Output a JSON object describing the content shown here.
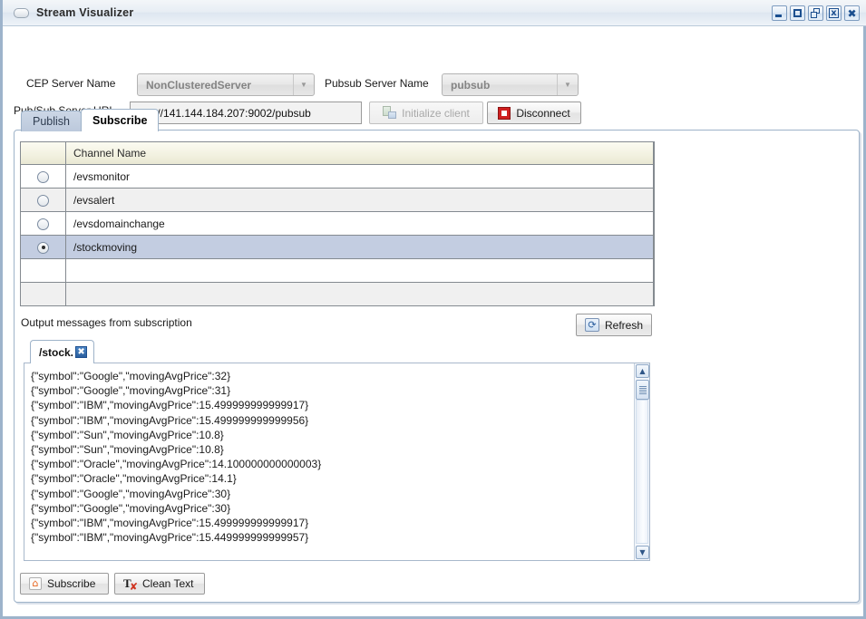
{
  "window": {
    "title": "Stream Visualizer",
    "icon": "pill-icon",
    "buttons": [
      {
        "name": "minimize",
        "label": "_"
      },
      {
        "name": "maximize",
        "label": "□"
      },
      {
        "name": "restore",
        "label": "❐"
      },
      {
        "name": "close-box",
        "label": "x"
      },
      {
        "name": "close",
        "label": "✖"
      }
    ]
  },
  "form": {
    "cep_server_label": "CEP Server Name",
    "cep_server_value": "NonClusteredServer",
    "pubsub_server_label": "Pubsub Server Name",
    "pubsub_server_value": "pubsub",
    "url_label": "Pub/Sub Server URL",
    "url_value": "http://141.144.184.207:9002/pubsub",
    "initialize_label": "Initialize client",
    "initialize_enabled": false,
    "disconnect_label": "Disconnect"
  },
  "tabs": [
    {
      "label": "Publish",
      "active": false
    },
    {
      "label": "Subscribe",
      "active": true
    }
  ],
  "channel_table": {
    "header": "Channel Name",
    "rows": [
      {
        "name": "/evsmonitor",
        "selected": false
      },
      {
        "name": "/evsalert",
        "selected": false
      },
      {
        "name": "/evsdomainchange",
        "selected": false
      },
      {
        "name": "/stockmoving",
        "selected": true
      },
      {
        "name": "",
        "selected": false
      },
      {
        "name": "",
        "selected": false
      }
    ]
  },
  "output": {
    "label": "Output messages from subscription",
    "refresh_label": "Refresh",
    "subtab_label": "/stock.",
    "subtab_close": "✖",
    "lines": [
      "{\"symbol\":\"Google\",\"movingAvgPrice\":32}",
      "{\"symbol\":\"Google\",\"movingAvgPrice\":31}",
      "{\"symbol\":\"IBM\",\"movingAvgPrice\":15.499999999999917}",
      "{\"symbol\":\"IBM\",\"movingAvgPrice\":15.499999999999956}",
      "{\"symbol\":\"Sun\",\"movingAvgPrice\":10.8}",
      "{\"symbol\":\"Sun\",\"movingAvgPrice\":10.8}",
      "{\"symbol\":\"Oracle\",\"movingAvgPrice\":14.100000000000003}",
      "{\"symbol\":\"Oracle\",\"movingAvgPrice\":14.1}",
      "{\"symbol\":\"Google\",\"movingAvgPrice\":30}",
      "{\"symbol\":\"Google\",\"movingAvgPrice\":30}",
      "{\"symbol\":\"IBM\",\"movingAvgPrice\":15.499999999999917}",
      "{\"symbol\":\"IBM\",\"movingAvgPrice\":15.449999999999957}"
    ],
    "scroll_up": "▲",
    "scroll_down": "▼"
  },
  "footer": {
    "subscribe_label": "Subscribe",
    "clean_text_label": "Clean Text"
  },
  "colors": {
    "accent_blue": "#9db3cb",
    "selected_row": "#c3cde1",
    "header_beige": "#f2f1e0",
    "disconnect_red": "#cf1f1f",
    "rss_orange": "#e8641c"
  }
}
